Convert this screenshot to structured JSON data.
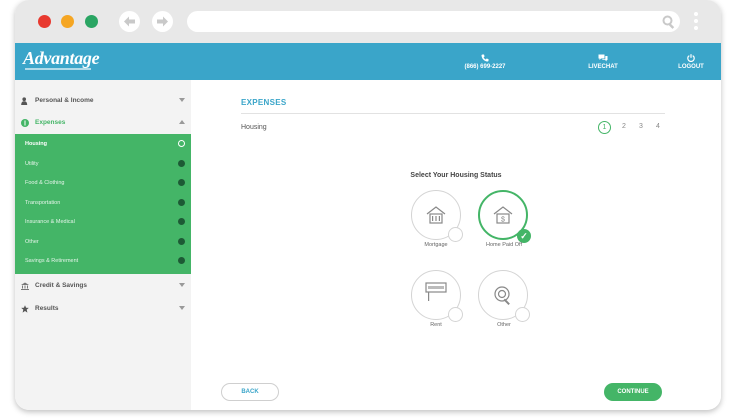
{
  "header": {
    "logo_text": "Advantage",
    "phone": "(866) 699-2227",
    "livechat": "LIVECHAT",
    "logout": "LOGOUT"
  },
  "sidebar": {
    "sections": [
      {
        "label": "Personal & Income"
      },
      {
        "label": "Expenses"
      },
      {
        "label": "Credit & Savings"
      },
      {
        "label": "Results"
      }
    ],
    "subitems": [
      {
        "label": "Housing",
        "status": "current"
      },
      {
        "label": "Utility",
        "status": "done"
      },
      {
        "label": "Food & Clothing",
        "status": "done"
      },
      {
        "label": "Transportation",
        "status": "done"
      },
      {
        "label": "Insurance & Medical",
        "status": "done"
      },
      {
        "label": "Other",
        "status": "done"
      },
      {
        "label": "Savings & Retirement",
        "status": "done"
      }
    ]
  },
  "main": {
    "title": "EXPENSES",
    "section": "Housing",
    "steps": [
      "1",
      "2",
      "3",
      "4"
    ],
    "question": "Select Your Housing Status",
    "options": [
      {
        "label": "Mortgage",
        "icon": "house-bank-icon",
        "selected": false
      },
      {
        "label": "Home Paid Off",
        "icon": "house-dollar-icon",
        "selected": true
      },
      {
        "label": "Rent",
        "icon": "rent-sign-icon",
        "selected": false
      },
      {
        "label": "Other",
        "icon": "search-icon",
        "selected": false
      }
    ],
    "back_label": "BACK",
    "continue_label": "CONTINUE"
  },
  "colors": {
    "brand_blue": "#3aa5c9",
    "accent_green": "#44b567",
    "red": "#e8392f",
    "yellow": "#f5a623",
    "green_dot": "#2aa563"
  }
}
